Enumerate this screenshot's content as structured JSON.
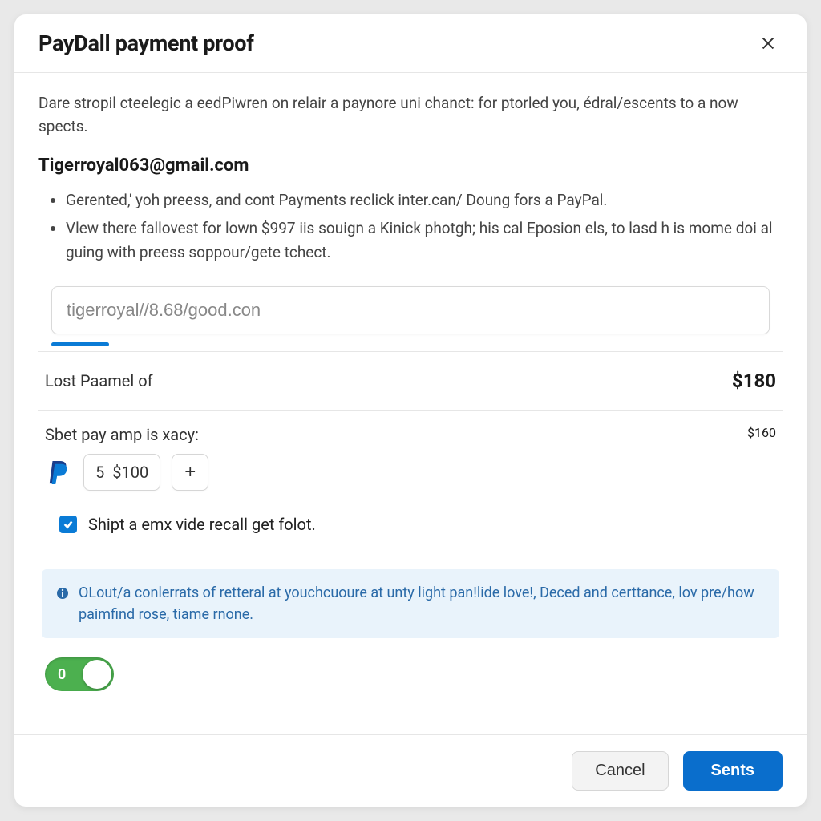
{
  "header": {
    "title": "PayDall payment proof"
  },
  "body": {
    "intro": "Dare stropil cteelegic a eedPiwren on relair a paynore uni chanct: for ptorled you, édral/escents to a now spects.",
    "email": "Tigerroyal063@gmail.com",
    "bullets": [
      "Gerented,' yoh preess, and cont Payments reclick inter.can/ Doung fors a PayPal.",
      "Vlew there fallovest for lown $997 iis souign a Kinick photgh; his cal Eposion els, to lasd h is mome doi al guing with preess soppour/gete tchect."
    ],
    "input_value": "tigerroyal//8.68/good.con",
    "progress_percent": 8,
    "line1": {
      "label": "Lost Paamel of",
      "amount": "$180"
    },
    "pay": {
      "label": "Sbet pay amp is xacy:",
      "qty": "5",
      "price": "$100",
      "amount": "$160"
    },
    "checkbox_label": "Shipt a emx vide recall get folot.",
    "info_text": "OLout/a conlerrats of retteral at youchcuoure at unty light pan!lide love!, Deced and certtance, lov pre/how paimfind rose, tiame rnone.",
    "toggle_label": "0"
  },
  "footer": {
    "cancel": "Cancel",
    "submit": "Sents"
  },
  "colors": {
    "accent": "#0a6ecc",
    "toggle_on": "#4cb04f"
  }
}
